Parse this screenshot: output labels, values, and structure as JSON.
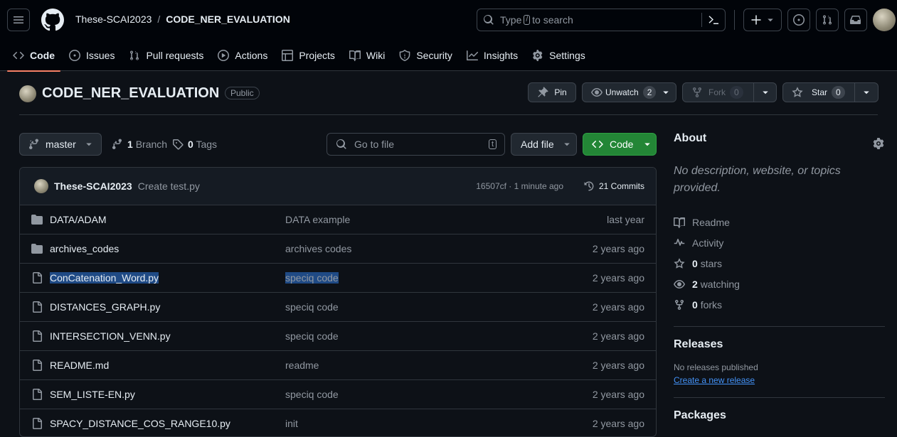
{
  "header": {
    "owner": "These-SCAI2023",
    "separator": "/",
    "repo": "CODE_NER_EVALUATION",
    "search_before": "Type",
    "search_key": "/",
    "search_after": "to search"
  },
  "nav": [
    {
      "label": "Code",
      "icon": "code-icon",
      "active": true
    },
    {
      "label": "Issues",
      "icon": "issue-icon"
    },
    {
      "label": "Pull requests",
      "icon": "pull-request-icon"
    },
    {
      "label": "Actions",
      "icon": "play-icon"
    },
    {
      "label": "Projects",
      "icon": "table-icon"
    },
    {
      "label": "Wiki",
      "icon": "book-icon"
    },
    {
      "label": "Security",
      "icon": "shield-icon"
    },
    {
      "label": "Insights",
      "icon": "graph-icon"
    },
    {
      "label": "Settings",
      "icon": "gear-icon"
    }
  ],
  "repo": {
    "title": "CODE_NER_EVALUATION",
    "visibility": "Public",
    "pin_label": "Pin",
    "unwatch_label": "Unwatch",
    "watch_count": "2",
    "fork_label": "Fork",
    "fork_count": "0",
    "star_label": "Star",
    "star_count": "0"
  },
  "toolbar": {
    "branch": "master",
    "branch_count": "1",
    "branch_label": "Branch",
    "tag_count": "0",
    "tag_label": "Tags",
    "goto_placeholder": "Go to file",
    "goto_key": "t",
    "add_file": "Add file",
    "code_button": "Code"
  },
  "commit": {
    "author": "These-SCAI2023",
    "message": "Create test.py",
    "meta": "16507cf · 1 minute ago",
    "commits": "21 Commits"
  },
  "files": [
    {
      "type": "folder",
      "name": "DATA/ADAM",
      "message": "DATA example",
      "time": "last year"
    },
    {
      "type": "folder",
      "name": "archives_codes",
      "message": "archives codes",
      "time": "2 years ago"
    },
    {
      "type": "file",
      "name": "ConCatenation_Word.py",
      "message": "speciq code",
      "time": "2 years ago",
      "selected": true
    },
    {
      "type": "file",
      "name": "DISTANCES_GRAPH.py",
      "message": "speciq code",
      "time": "2 years ago"
    },
    {
      "type": "file",
      "name": "INTERSECTION_VENN.py",
      "message": "speciq code",
      "time": "2 years ago"
    },
    {
      "type": "file",
      "name": "README.md",
      "message": "readme",
      "time": "2 years ago"
    },
    {
      "type": "file",
      "name": "SEM_LISTE-EN.py",
      "message": "speciq code",
      "time": "2 years ago"
    },
    {
      "type": "file",
      "name": "SPACY_DISTANCE_COS_RANGE10.py",
      "message": "init",
      "time": "2 years ago"
    }
  ],
  "about": {
    "title": "About",
    "description": "No description, website, or topics provided.",
    "readme": "Readme",
    "activity": "Activity",
    "stars_count": "0",
    "stars_label": "stars",
    "watching_count": "2",
    "watching_label": "watching",
    "forks_count": "0",
    "forks_label": "forks"
  },
  "releases": {
    "title": "Releases",
    "none": "No releases published",
    "create": "Create a new release"
  },
  "packages": {
    "title": "Packages"
  },
  "colors": {
    "accent_green": "#238636",
    "link_blue": "#4493f8",
    "selection": "#1f4a85",
    "active_tab": "#f78166"
  }
}
